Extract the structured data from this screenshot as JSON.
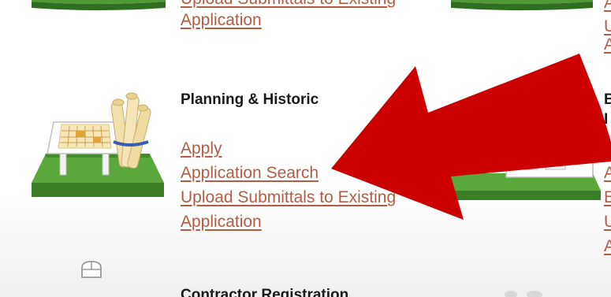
{
  "top_section": {
    "link_upload_line1": "Upload Submittals to Existing",
    "link_upload_line2": "Application"
  },
  "planning_section": {
    "heading": "Planning & Historic",
    "links": {
      "apply": "Apply",
      "search": "Application Search",
      "upload_line1": "Upload Submittals to Existing",
      "upload_line2": "Application"
    },
    "icon": "blueprint-scrolls-icon"
  },
  "right_column": {
    "heading_fragment_1": "B",
    "heading_fragment_2": "I",
    "link_fragments_top": [
      "A",
      "U",
      "A"
    ],
    "link_fragments_mid": [
      "A",
      "E",
      "U",
      "A"
    ],
    "icon": "building-permit-icon"
  },
  "bottom_section": {
    "heading_partial": "Contractor Registration",
    "icon": "contractor-icon"
  },
  "overlay": {
    "arrow_icon": "red-arrow-icon",
    "arrow_color": "#cc0000"
  },
  "colors": {
    "link": "#b35c43",
    "heading": "#1a1a1a",
    "icon_green": "#3f8a2c"
  }
}
